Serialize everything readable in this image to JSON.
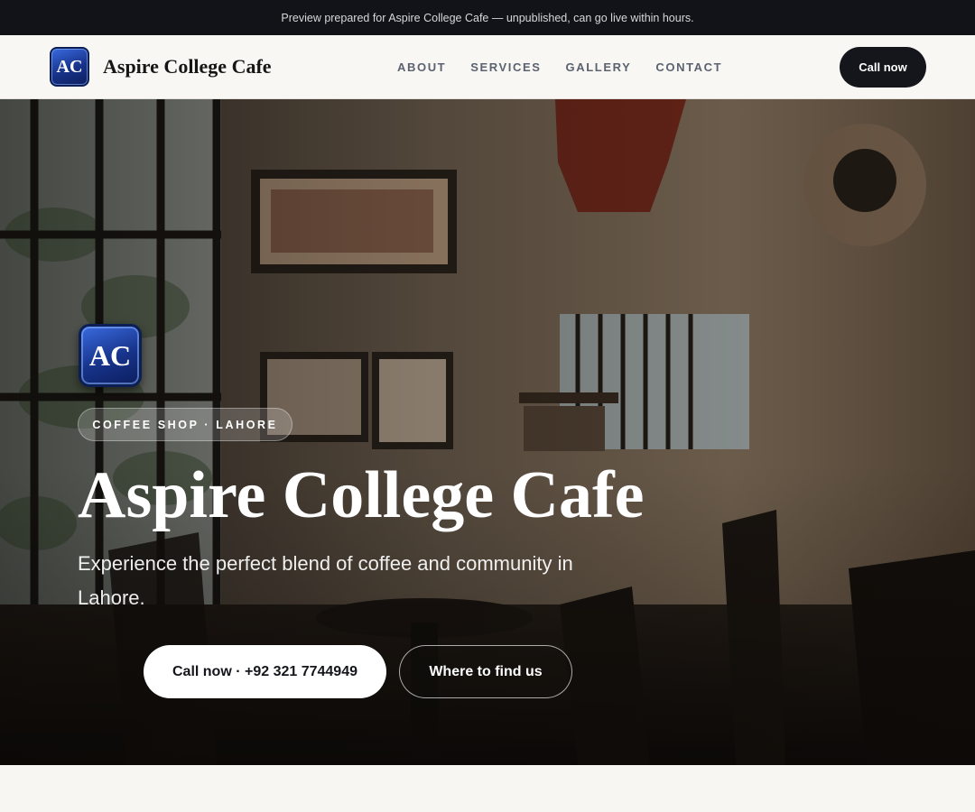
{
  "preview_bar": {
    "text": "Preview prepared for Aspire College Cafe — unpublished, can go live within hours."
  },
  "nav": {
    "logo_initials": "AC",
    "brand_name": "Aspire College Cafe",
    "links": [
      "ABOUT",
      "SERVICES",
      "GALLERY",
      "CONTACT"
    ],
    "call_label": "Call now"
  },
  "hero": {
    "logo_initials": "AC",
    "badge": "COFFEE SHOP · LAHORE",
    "title": "Aspire College Cafe",
    "subtitle": "Experience the perfect blend of coffee and community in Lahore.",
    "primary_button": "Call now · +92 321 7744949",
    "secondary_button": "Where to find us"
  },
  "colors": {
    "dark": "#14161b",
    "logo_blue": "#17338a",
    "page_bg": "#f8f6f2"
  }
}
